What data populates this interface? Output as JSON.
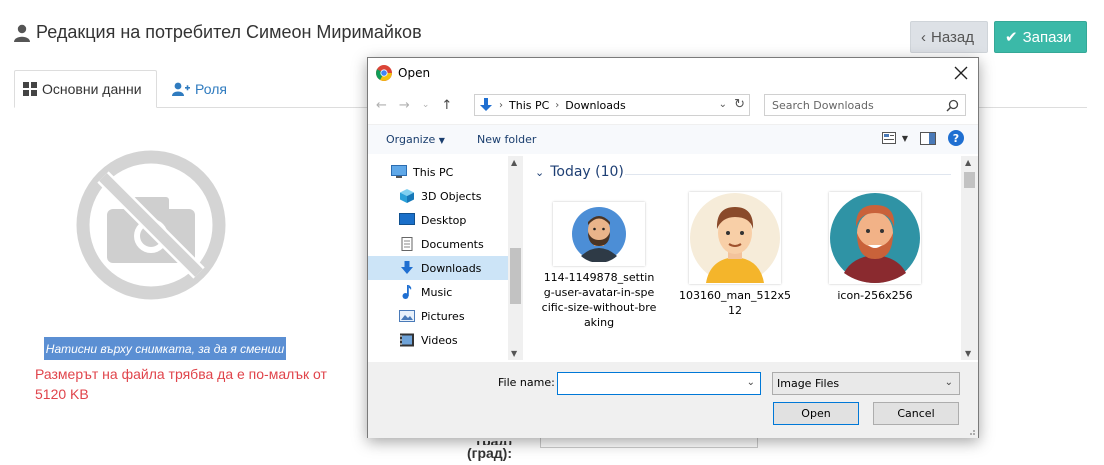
{
  "page": {
    "title": "Редакция на потребител Симеон Миримайков",
    "back_label": "Назад",
    "save_label": "Запази",
    "tabs": [
      {
        "label": "Основни данни"
      },
      {
        "label": "Роля"
      }
    ],
    "photo_hint": "Натисни върху снимката, за да я смениш",
    "size_note": "Размерът на файла трябва да е по-малък от 5120 KB",
    "form_label_line1": "град)",
    "form_label_line2": "(град):"
  },
  "dialog": {
    "title": "Open",
    "address": {
      "segments": [
        "This PC",
        "Downloads"
      ]
    },
    "search_placeholder": "Search Downloads",
    "toolbar": {
      "organize": "Organize",
      "new_folder": "New folder"
    },
    "tree": [
      {
        "label": "This PC",
        "icon": "pc-icon"
      },
      {
        "label": "3D Objects",
        "icon": "cube-icon"
      },
      {
        "label": "Desktop",
        "icon": "desktop-icon"
      },
      {
        "label": "Documents",
        "icon": "document-icon"
      },
      {
        "label": "Downloads",
        "icon": "download-icon",
        "selected": true
      },
      {
        "label": "Music",
        "icon": "music-icon"
      },
      {
        "label": "Pictures",
        "icon": "picture-icon"
      },
      {
        "label": "Videos",
        "icon": "video-icon"
      }
    ],
    "group": {
      "label": "Today (10)"
    },
    "files": [
      {
        "name": "114-1149878_setting-user-avatar-in-specific-size-without-breaking"
      },
      {
        "name": "103160_man_512x512"
      },
      {
        "name": "icon-256x256"
      }
    ],
    "file_name_label": "File name:",
    "file_name_value": "",
    "file_type": "Image Files",
    "open_label": "Open",
    "cancel_label": "Cancel"
  },
  "colors": {
    "accent": "#3bb9a8",
    "link": "#2f7bbf",
    "error": "#e0444b",
    "hint_bg": "#5b8fd3",
    "win_blue": "#0078d7"
  }
}
